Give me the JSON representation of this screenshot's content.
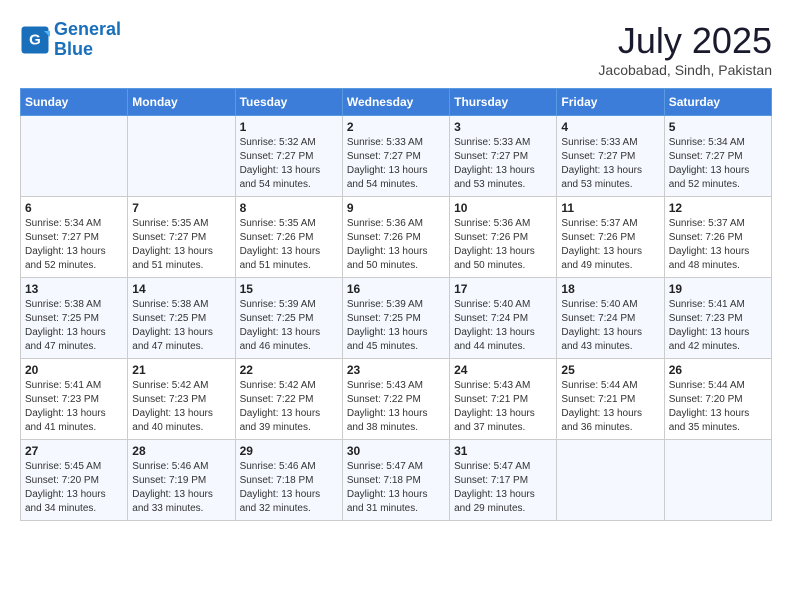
{
  "logo": {
    "line1": "General",
    "line2": "Blue"
  },
  "title": "July 2025",
  "location": "Jacobabad, Sindh, Pakistan",
  "days_header": [
    "Sunday",
    "Monday",
    "Tuesday",
    "Wednesday",
    "Thursday",
    "Friday",
    "Saturday"
  ],
  "weeks": [
    [
      {
        "day": "",
        "info": ""
      },
      {
        "day": "",
        "info": ""
      },
      {
        "day": "1",
        "info": "Sunrise: 5:32 AM\nSunset: 7:27 PM\nDaylight: 13 hours and 54 minutes."
      },
      {
        "day": "2",
        "info": "Sunrise: 5:33 AM\nSunset: 7:27 PM\nDaylight: 13 hours and 54 minutes."
      },
      {
        "day": "3",
        "info": "Sunrise: 5:33 AM\nSunset: 7:27 PM\nDaylight: 13 hours and 53 minutes."
      },
      {
        "day": "4",
        "info": "Sunrise: 5:33 AM\nSunset: 7:27 PM\nDaylight: 13 hours and 53 minutes."
      },
      {
        "day": "5",
        "info": "Sunrise: 5:34 AM\nSunset: 7:27 PM\nDaylight: 13 hours and 52 minutes."
      }
    ],
    [
      {
        "day": "6",
        "info": "Sunrise: 5:34 AM\nSunset: 7:27 PM\nDaylight: 13 hours and 52 minutes."
      },
      {
        "day": "7",
        "info": "Sunrise: 5:35 AM\nSunset: 7:27 PM\nDaylight: 13 hours and 51 minutes."
      },
      {
        "day": "8",
        "info": "Sunrise: 5:35 AM\nSunset: 7:26 PM\nDaylight: 13 hours and 51 minutes."
      },
      {
        "day": "9",
        "info": "Sunrise: 5:36 AM\nSunset: 7:26 PM\nDaylight: 13 hours and 50 minutes."
      },
      {
        "day": "10",
        "info": "Sunrise: 5:36 AM\nSunset: 7:26 PM\nDaylight: 13 hours and 50 minutes."
      },
      {
        "day": "11",
        "info": "Sunrise: 5:37 AM\nSunset: 7:26 PM\nDaylight: 13 hours and 49 minutes."
      },
      {
        "day": "12",
        "info": "Sunrise: 5:37 AM\nSunset: 7:26 PM\nDaylight: 13 hours and 48 minutes."
      }
    ],
    [
      {
        "day": "13",
        "info": "Sunrise: 5:38 AM\nSunset: 7:25 PM\nDaylight: 13 hours and 47 minutes."
      },
      {
        "day": "14",
        "info": "Sunrise: 5:38 AM\nSunset: 7:25 PM\nDaylight: 13 hours and 47 minutes."
      },
      {
        "day": "15",
        "info": "Sunrise: 5:39 AM\nSunset: 7:25 PM\nDaylight: 13 hours and 46 minutes."
      },
      {
        "day": "16",
        "info": "Sunrise: 5:39 AM\nSunset: 7:25 PM\nDaylight: 13 hours and 45 minutes."
      },
      {
        "day": "17",
        "info": "Sunrise: 5:40 AM\nSunset: 7:24 PM\nDaylight: 13 hours and 44 minutes."
      },
      {
        "day": "18",
        "info": "Sunrise: 5:40 AM\nSunset: 7:24 PM\nDaylight: 13 hours and 43 minutes."
      },
      {
        "day": "19",
        "info": "Sunrise: 5:41 AM\nSunset: 7:23 PM\nDaylight: 13 hours and 42 minutes."
      }
    ],
    [
      {
        "day": "20",
        "info": "Sunrise: 5:41 AM\nSunset: 7:23 PM\nDaylight: 13 hours and 41 minutes."
      },
      {
        "day": "21",
        "info": "Sunrise: 5:42 AM\nSunset: 7:23 PM\nDaylight: 13 hours and 40 minutes."
      },
      {
        "day": "22",
        "info": "Sunrise: 5:42 AM\nSunset: 7:22 PM\nDaylight: 13 hours and 39 minutes."
      },
      {
        "day": "23",
        "info": "Sunrise: 5:43 AM\nSunset: 7:22 PM\nDaylight: 13 hours and 38 minutes."
      },
      {
        "day": "24",
        "info": "Sunrise: 5:43 AM\nSunset: 7:21 PM\nDaylight: 13 hours and 37 minutes."
      },
      {
        "day": "25",
        "info": "Sunrise: 5:44 AM\nSunset: 7:21 PM\nDaylight: 13 hours and 36 minutes."
      },
      {
        "day": "26",
        "info": "Sunrise: 5:44 AM\nSunset: 7:20 PM\nDaylight: 13 hours and 35 minutes."
      }
    ],
    [
      {
        "day": "27",
        "info": "Sunrise: 5:45 AM\nSunset: 7:20 PM\nDaylight: 13 hours and 34 minutes."
      },
      {
        "day": "28",
        "info": "Sunrise: 5:46 AM\nSunset: 7:19 PM\nDaylight: 13 hours and 33 minutes."
      },
      {
        "day": "29",
        "info": "Sunrise: 5:46 AM\nSunset: 7:18 PM\nDaylight: 13 hours and 32 minutes."
      },
      {
        "day": "30",
        "info": "Sunrise: 5:47 AM\nSunset: 7:18 PM\nDaylight: 13 hours and 31 minutes."
      },
      {
        "day": "31",
        "info": "Sunrise: 5:47 AM\nSunset: 7:17 PM\nDaylight: 13 hours and 29 minutes."
      },
      {
        "day": "",
        "info": ""
      },
      {
        "day": "",
        "info": ""
      }
    ]
  ]
}
